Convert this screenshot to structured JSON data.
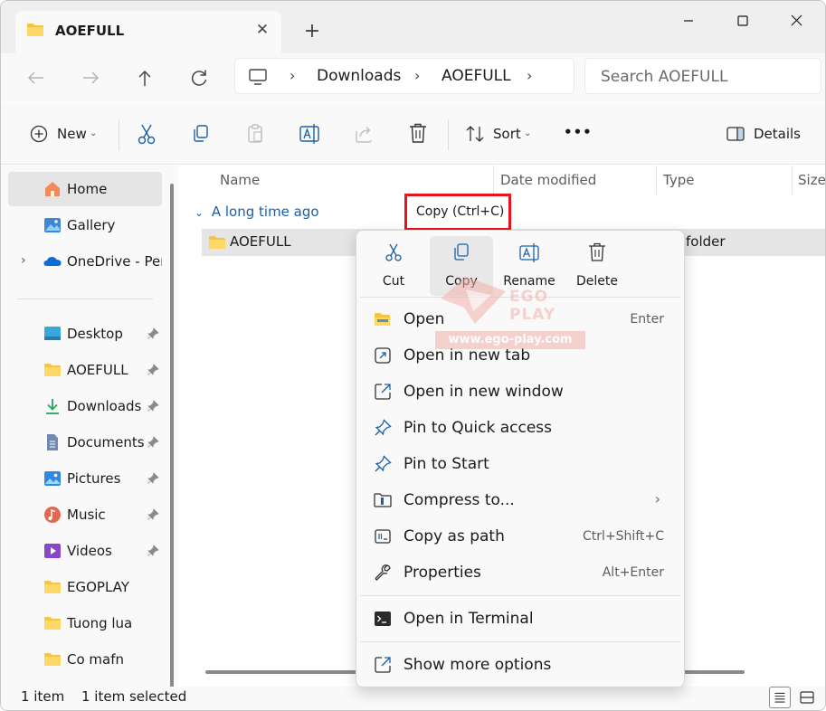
{
  "window": {
    "tab_title": "AOEFULL",
    "icons": {
      "close": "close-icon",
      "new_tab": "plus-icon",
      "minimize": "minimize-icon",
      "maximize": "maximize-icon",
      "window_close": "close-icon"
    }
  },
  "address": {
    "crumbs": [
      "Downloads",
      "AOEFULL"
    ],
    "search_placeholder": "Search AOEFULL"
  },
  "toolbar": {
    "new_label": "New",
    "sort_label": "Sort",
    "more_label": "•••",
    "details_label": "Details"
  },
  "sidebar": {
    "items": [
      {
        "label": "Home",
        "icon": "home-icon"
      },
      {
        "label": "Gallery",
        "icon": "gallery-icon"
      },
      {
        "label": "OneDrive - Perso",
        "icon": "onedrive-icon"
      },
      {
        "label": "Desktop",
        "icon": "desktop-icon"
      },
      {
        "label": "AOEFULL",
        "icon": "folder-icon"
      },
      {
        "label": "Downloads",
        "icon": "download-icon"
      },
      {
        "label": "Documents",
        "icon": "documents-icon"
      },
      {
        "label": "Pictures",
        "icon": "pictures-icon"
      },
      {
        "label": "Music",
        "icon": "music-icon"
      },
      {
        "label": "Videos",
        "icon": "videos-icon"
      },
      {
        "label": "EGOPLAY",
        "icon": "folder-icon"
      },
      {
        "label": "Tuong lua",
        "icon": "folder-icon"
      },
      {
        "label": "Co mafn",
        "icon": "folder-icon"
      }
    ]
  },
  "content": {
    "columns": [
      "Name",
      "Date modified",
      "Type",
      "Size"
    ],
    "group": "A long time ago",
    "row": {
      "name": "AOEFULL",
      "type": "folder"
    }
  },
  "status": {
    "count": "1 item",
    "selected": "1 item selected"
  },
  "tooltip": {
    "text": "Copy (Ctrl+C)"
  },
  "context_menu": {
    "quick": [
      {
        "label": "Cut",
        "icon": "cut-icon"
      },
      {
        "label": "Copy",
        "icon": "copy-icon"
      },
      {
        "label": "Rename",
        "icon": "rename-icon"
      },
      {
        "label": "Delete",
        "icon": "delete-icon"
      }
    ],
    "items": [
      {
        "label": "Open",
        "shortcut": "Enter",
        "icon": "folder-open-icon"
      },
      {
        "label": "Open in new tab",
        "shortcut": "",
        "icon": "new-tab-icon"
      },
      {
        "label": "Open in new window",
        "shortcut": "",
        "icon": "new-window-icon"
      },
      {
        "label": "Pin to Quick access",
        "shortcut": "",
        "icon": "pin-icon"
      },
      {
        "label": "Pin to Start",
        "shortcut": "",
        "icon": "pin-icon"
      },
      {
        "label": "Compress to...",
        "shortcut": "",
        "icon": "zip-icon"
      },
      {
        "label": "Copy as path",
        "shortcut": "Ctrl+Shift+C",
        "icon": "copy-path-icon"
      },
      {
        "label": "Properties",
        "shortcut": "Alt+Enter",
        "icon": "wrench-icon"
      },
      {
        "label": "Open in Terminal",
        "shortcut": "",
        "icon": "terminal-icon"
      },
      {
        "label": "Show more options",
        "shortcut": "",
        "icon": "more-options-icon"
      }
    ],
    "compress_arrow": "›"
  },
  "watermark": {
    "brand": "EGO PLAY",
    "url": "www.ego-play.com"
  },
  "colors": {
    "accent": "#1c5fa8",
    "folder": "#f4c542",
    "highlight_border": "#e8131b"
  }
}
